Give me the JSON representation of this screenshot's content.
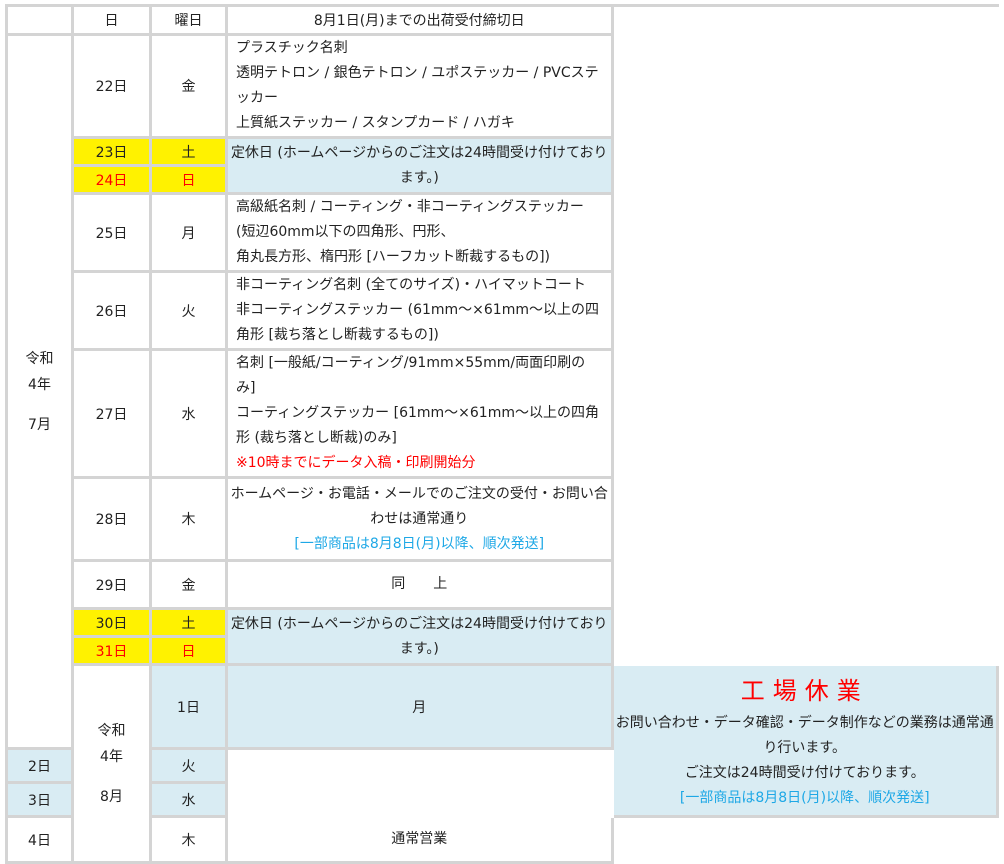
{
  "header": {
    "day": "日",
    "weekday": "曜日",
    "title": "8月1日(月)までの出荷受付締切日"
  },
  "july": {
    "era": "令和",
    "year": "4年",
    "month": "7月"
  },
  "august": {
    "era": "令和",
    "year": "4年",
    "month": "8月"
  },
  "rows": {
    "r22": {
      "day": "22日",
      "wd": "金",
      "l1": "プラスチック名刺",
      "l2": "透明テトロン / 銀色テトロン / ユポステッカー / PVCステッカー",
      "l3": "上質紙ステッカー / スタンプカード / ハガキ"
    },
    "r23": {
      "day": "23日",
      "wd": "土"
    },
    "r24": {
      "day": "24日",
      "wd": "日"
    },
    "holiday1": "定休日 (ホームページからのご注文は24時間受け付けております。)",
    "r25": {
      "day": "25日",
      "wd": "月",
      "l1": "高級紙名刺 / コーティング・非コーティングステッカー (短辺60mm以下の四角形、円形、",
      "l2": "角丸長方形、楕円形 [ハーフカット断裁するもの])"
    },
    "r26": {
      "day": "26日",
      "wd": "火",
      "l1": "非コーティング名刺 (全てのサイズ)・ハイマットコート",
      "l2": "非コーティングステッカー (61mm～×61mm～以上の四角形 [裁ち落とし断裁するもの])"
    },
    "r27": {
      "day": "27日",
      "wd": "水",
      "l1": "名刺 [一般紙/コーティング/91mm×55mm/両面印刷のみ]",
      "l2": "コーティングステッカー [61mm～×61mm～以上の四角形 (裁ち落とし断裁)のみ]",
      "l3": "※10時までにデータ入稿・印刷開始分"
    },
    "r28": {
      "day": "28日",
      "wd": "木",
      "l1": "ホームページ・お電話・メールでのご注文の受付・お問い合わせは通常通り",
      "l2": "[一部商品は8月8日(月)以降、順次発送]"
    },
    "r29": {
      "day": "29日",
      "wd": "金",
      "same1": "同",
      "same2": "上"
    },
    "r30": {
      "day": "30日",
      "wd": "土"
    },
    "r31": {
      "day": "31日",
      "wd": "日"
    },
    "holiday2": "定休日 (ホームページからのご注文は24時間受け付けております。)",
    "a1": {
      "day": "1日",
      "wd": "月"
    },
    "a2": {
      "day": "2日",
      "wd": "火"
    },
    "a3": {
      "day": "3日",
      "wd": "水"
    },
    "factory": {
      "title": "工場休業",
      "l1": "お問い合わせ・データ確認・データ制作などの業務は通常通り行います。",
      "l2": "ご注文は24時間受け付けております。",
      "l3": "[一部商品は8月8日(月)以降、順次発送]"
    },
    "a4": {
      "day": "4日",
      "wd": "木",
      "text": "通常営業"
    }
  },
  "colors": {
    "weekend": "#fff200",
    "closed": "#d9ecf3",
    "border": "#d4d4d4",
    "alert": "#ff0000",
    "notice": "#1ea8e6"
  }
}
